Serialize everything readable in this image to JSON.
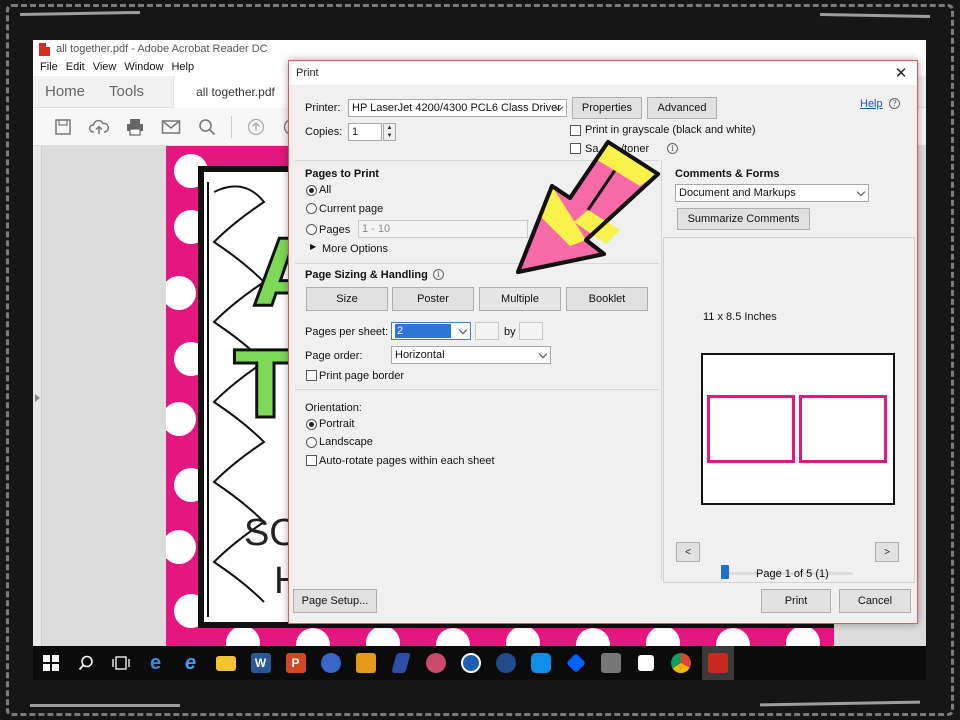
{
  "app": {
    "window_title": "all together.pdf - Adobe Acrobat Reader DC",
    "menu": [
      "File",
      "Edit",
      "View",
      "Window",
      "Help"
    ],
    "tabs": {
      "home": "Home",
      "tools": "Tools",
      "document": "all together.pdf"
    }
  },
  "print_dialog": {
    "title": "Print",
    "printer_label": "Printer:",
    "printer_value": "HP LaserJet 4200/4300 PCL6 Class Driver",
    "properties_label": "Properties",
    "advanced_label": "Advanced",
    "help_label": "Help",
    "copies_label": "Copies:",
    "copies_value": "1",
    "grayscale_label": "Print in grayscale (black and white)",
    "save_ink_label_a": "Sa",
    "save_ink_label_b": "/toner",
    "pages_to_print": {
      "heading": "Pages to Print",
      "all": "All",
      "current": "Current page",
      "pages": "Pages",
      "pages_range": "1 - 10",
      "more_options": "More Options"
    },
    "sizing": {
      "heading": "Page Sizing & Handling",
      "buttons": [
        "Size",
        "Poster",
        "Multiple",
        "Booklet"
      ],
      "pages_per_sheet_label": "Pages per sheet:",
      "pages_per_sheet_value": "2",
      "by_label": "by",
      "page_order_label": "Page order:",
      "page_order_value": "Horizontal",
      "border_label": "Print page border"
    },
    "orientation": {
      "heading": "Orientation:",
      "portrait": "Portrait",
      "landscape": "Landscape",
      "auto_rotate": "Auto-rotate pages within each sheet"
    },
    "comments": {
      "heading": "Comments & Forms",
      "value": "Document and Markups",
      "summarize": "Summarize Comments"
    },
    "preview": {
      "size_label": "11 x 8.5 Inches",
      "page_info": "Page 1 of 5 (1)",
      "prev": "<",
      "next": ">"
    },
    "page_setup_label": "Page Setup...",
    "print_label": "Print",
    "cancel_label": "Cancel"
  },
  "page_preview_text": {
    "big_letters_a": "A",
    "big_letters_t": "T",
    "line_so": "SO",
    "line_h": "H"
  },
  "colors": {
    "accent": "#e3177f",
    "select_blue": "#2f75d6",
    "link": "#1a55c4"
  }
}
